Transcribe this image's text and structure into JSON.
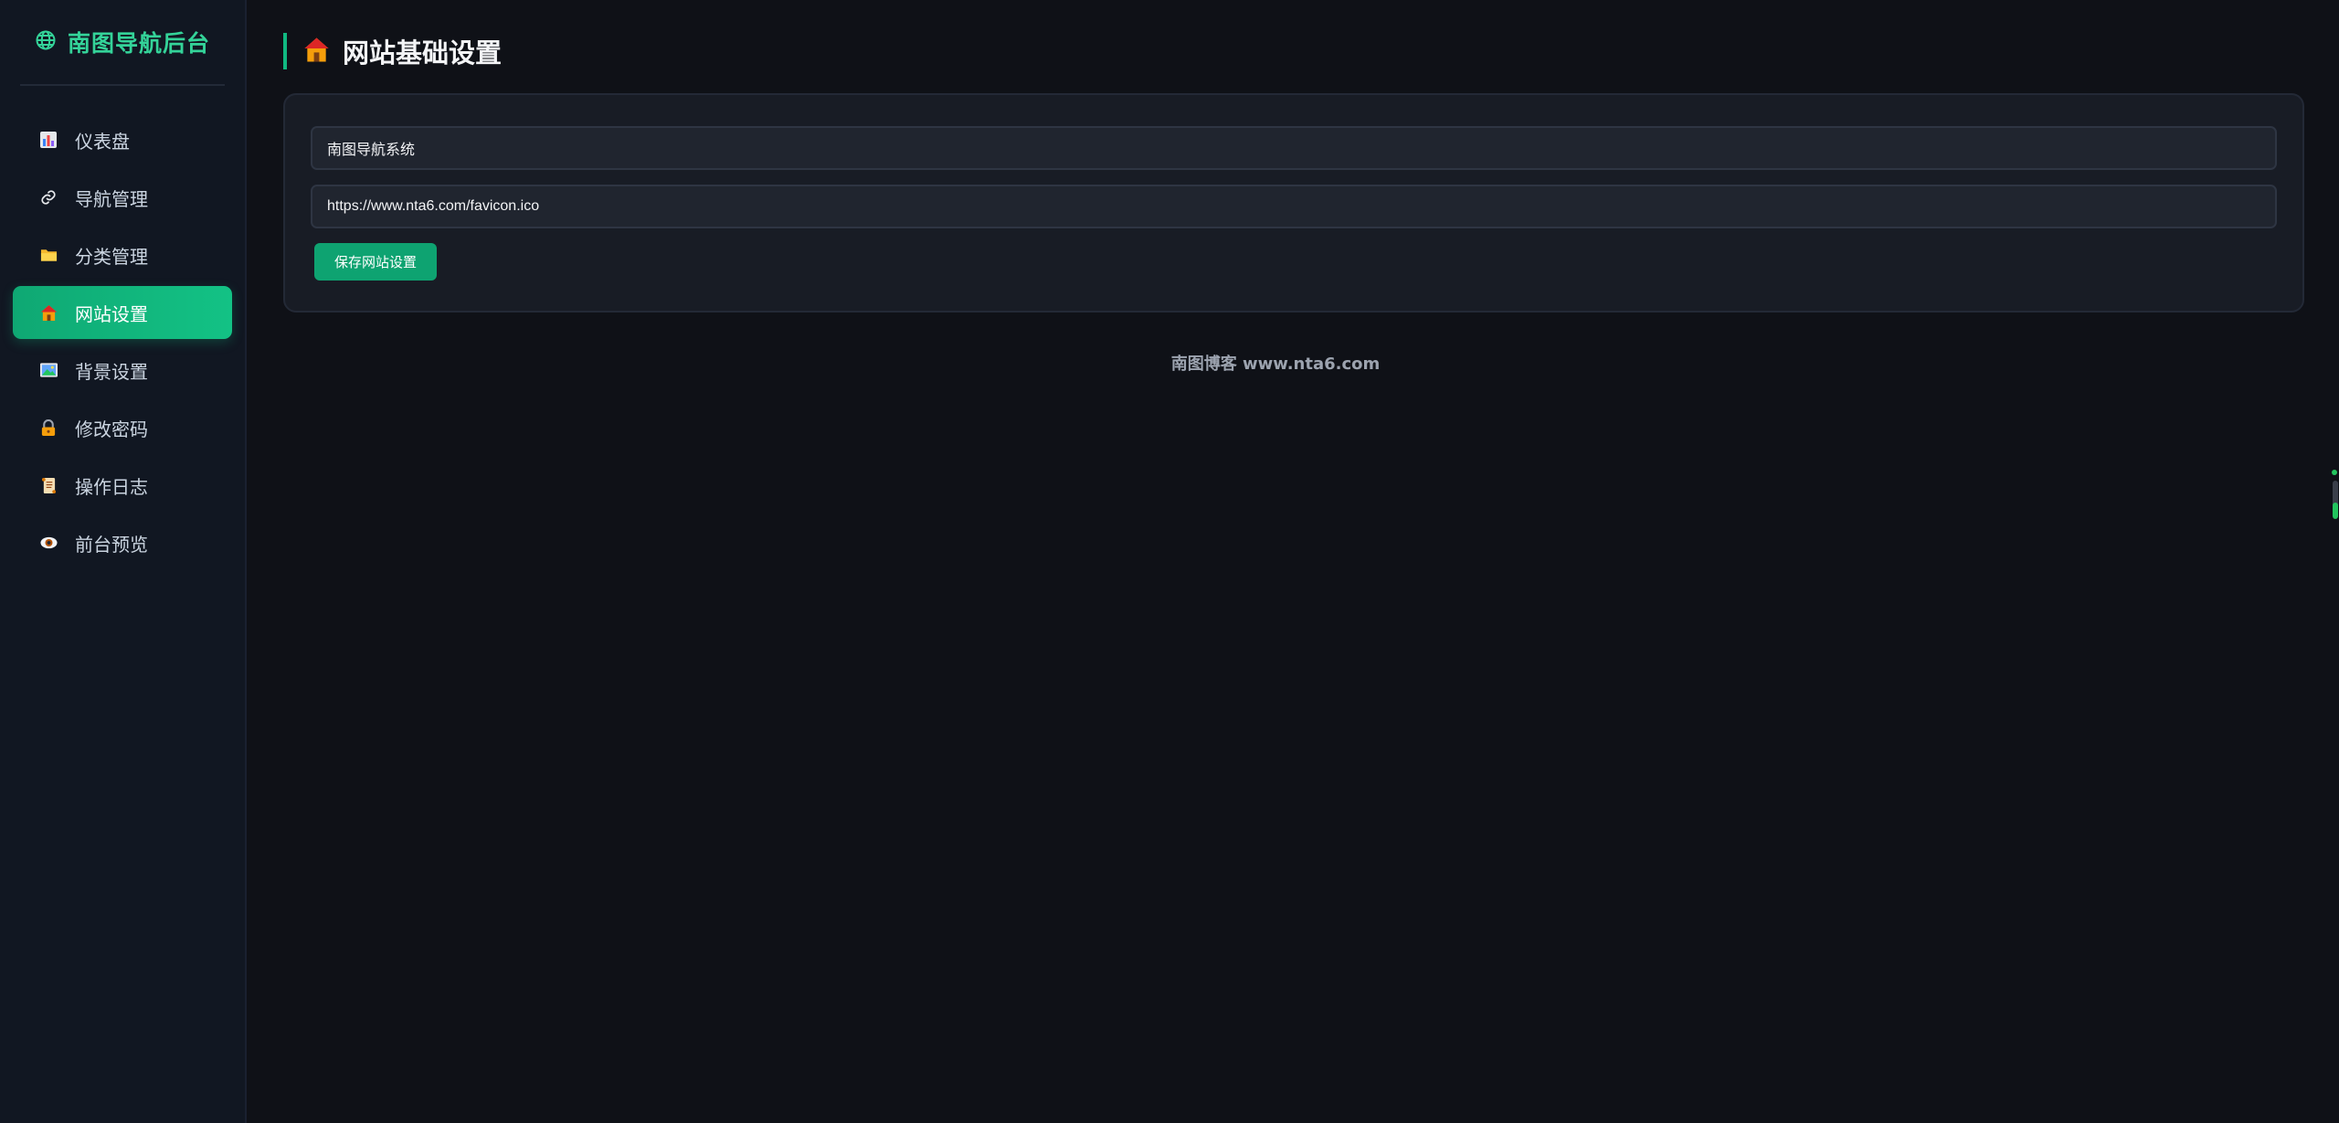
{
  "sidebar": {
    "brand": {
      "title": "南图导航后台",
      "icon": "globe-icon",
      "color": "#34d399"
    },
    "items": [
      {
        "label": "仪表盘",
        "icon": "bar-chart-icon",
        "active": false
      },
      {
        "label": "导航管理",
        "icon": "link-icon",
        "active": false
      },
      {
        "label": "分类管理",
        "icon": "folder-icon",
        "active": false
      },
      {
        "label": "网站设置",
        "icon": "house-icon",
        "active": true
      },
      {
        "label": "背景设置",
        "icon": "image-icon",
        "active": false
      },
      {
        "label": "修改密码",
        "icon": "lock-icon",
        "active": false
      },
      {
        "label": "操作日志",
        "icon": "scroll-icon",
        "active": false
      },
      {
        "label": "前台预览",
        "icon": "eye-icon",
        "active": false
      }
    ]
  },
  "main": {
    "title": "网站基础设置",
    "title_icon": "house-icon",
    "fields": {
      "site_name": {
        "value": "南图导航系统"
      },
      "favicon_url": {
        "value": "https://www.nta6.com/favicon.ico"
      }
    },
    "save_label": "保存网站设置"
  },
  "footer": {
    "text": "南图博客 www.nta6.com"
  },
  "colors": {
    "accent": "#10b981",
    "background": "#0f1117",
    "sidebar": "#111722",
    "card": "#181c25"
  }
}
